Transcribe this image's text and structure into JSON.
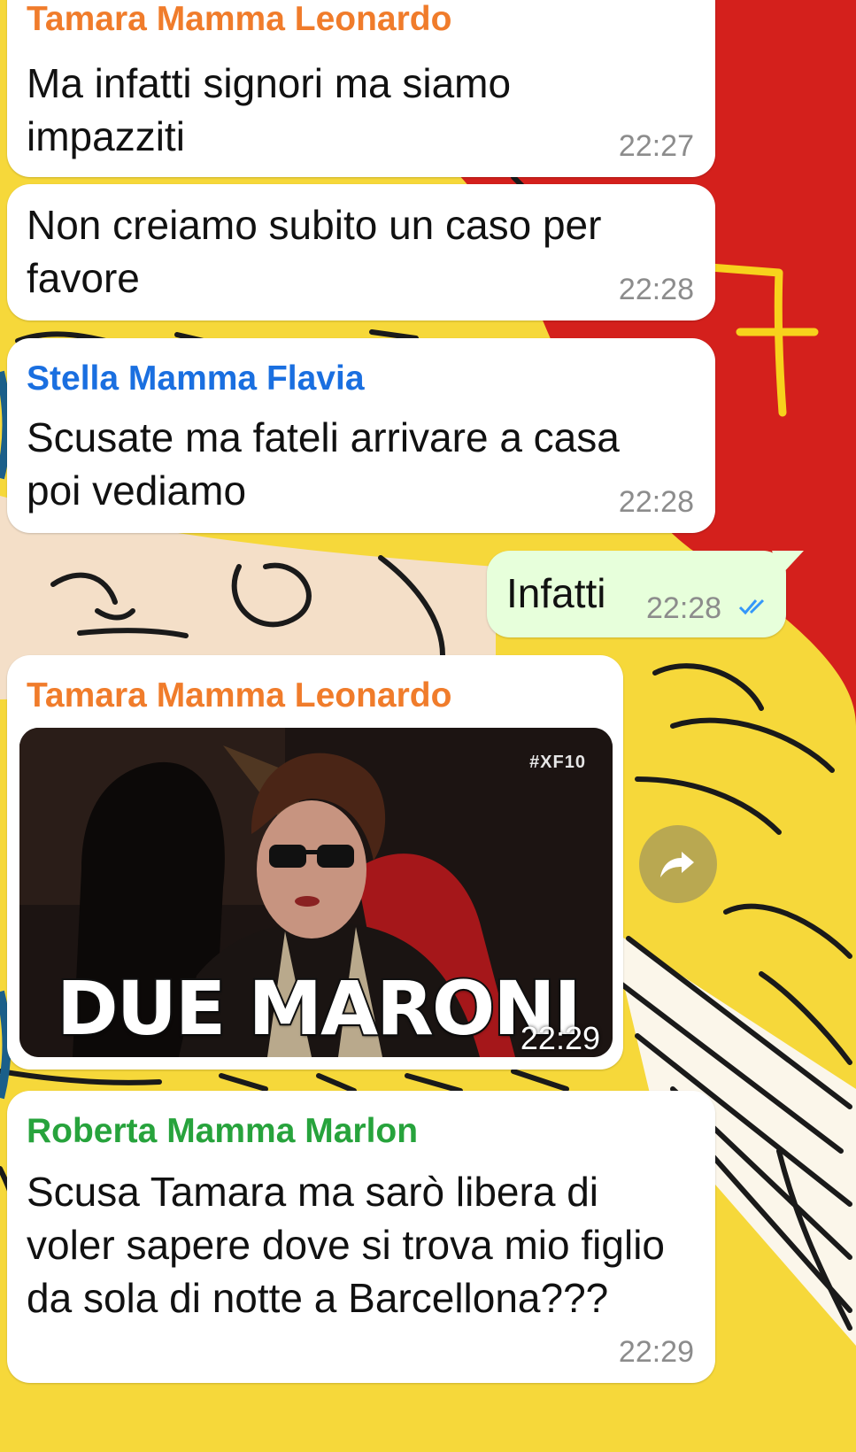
{
  "colors": {
    "sender_orange": "#f07c2b",
    "sender_blue": "#1a6fe0",
    "sender_green": "#27a33c",
    "read_ticks": "#3497f9",
    "outgoing_bubble": "#e7ffdb",
    "wallpaper_red": "#d4201c",
    "wallpaper_yellow": "#f6d83a"
  },
  "messages": [
    {
      "sender": "Tamara Mamma Leonardo",
      "text": "Ma infatti signori ma siamo\nimpazziti",
      "time": "22:27"
    },
    {
      "sender": "",
      "text": "Non creiamo subito un caso per\nfavore",
      "time": "22:28"
    },
    {
      "sender": "Stella Mamma Flavia",
      "text": "Scusate ma fateli arrivare a casa\npoi vediamo",
      "time": "22:28"
    },
    {
      "sender": "",
      "text": "Infatti",
      "time": "22:28",
      "status_icon": "double-check-read-icon"
    },
    {
      "sender": "Tamara Mamma Leonardo",
      "gif": {
        "tag": "#XF10",
        "caption": "DUE MARONI"
      },
      "time": "22:29",
      "forward_icon": "forward-arrow-icon"
    },
    {
      "sender": "Roberta Mamma Marlon",
      "text": "Scusa Tamara ma sarò libera di\nvoler sapere dove si trova mio figlio\nda sola di notte a Barcellona???",
      "time": "22:29"
    }
  ]
}
